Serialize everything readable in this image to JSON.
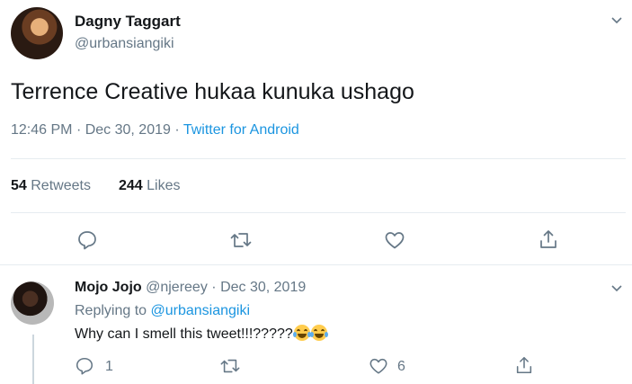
{
  "tweet": {
    "author_name": "Dagny Taggart",
    "author_handle": "@urbansiangiki",
    "text": "Terrence Creative hukaa kunuka ushago",
    "time": "12:46 PM",
    "separator": "·",
    "date": "Dec 30, 2019",
    "source": "Twitter for Android",
    "retweets_count": "54",
    "retweets_label": "Retweets",
    "likes_count": "244",
    "likes_label": "Likes"
  },
  "reply": {
    "author_name": "Mojo Jojo",
    "author_handle": "@njereey",
    "separator": "·",
    "date": "Dec 30, 2019",
    "replying_to_label": "Replying to",
    "replying_to_handle": "@urbansiangiki",
    "text": "Why can I smell this tweet!!!?????",
    "emoji": "face-with-tears-of-joy ×2",
    "reply_count": "1",
    "like_count": "6"
  },
  "colors": {
    "text": "#14171a",
    "secondary": "#657786",
    "link": "#1b95e0",
    "divider": "#e6ecf0",
    "icon": "#657786"
  },
  "icons": [
    "chevron-down-icon",
    "reply-icon",
    "retweet-icon",
    "like-icon",
    "share-icon"
  ]
}
